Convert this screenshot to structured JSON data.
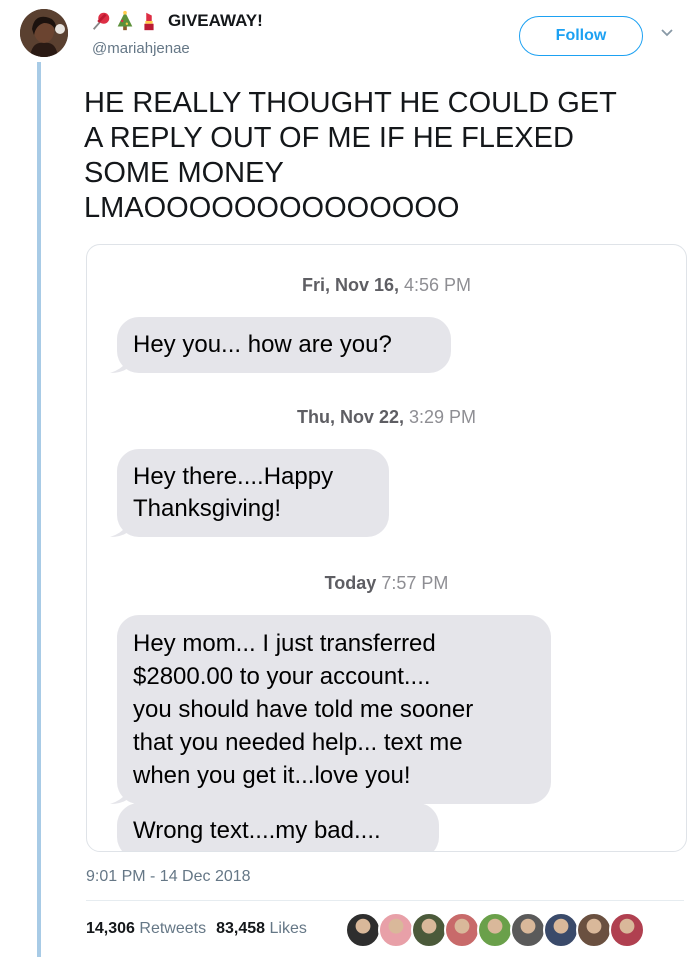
{
  "tweet": {
    "display_name": "GIVEAWAY!",
    "name_emojis": [
      "pushpin-emoji",
      "christmas-tree-emoji",
      "lipstick-emoji"
    ],
    "handle": "@mariahjenae",
    "follow_label": "Follow",
    "text": "HE REALLY THOUGHT HE COULD GET\nA REPLY OUT OF ME IF HE FLEXED\nSOME MONEY\nLMAOOOOOOOOOOOOOO",
    "timestamp": "9:01 PM - 14 Dec 2018",
    "retweets_count": "14,306",
    "retweets_label": "Retweets",
    "likes_count": "83,458",
    "likes_label": "Likes"
  },
  "messages": {
    "time1_day": "Fri, Nov 16,",
    "time1_clock": "4:56 PM",
    "bubble1": "Hey you... how are you?",
    "time2_day": "Thu, Nov 22,",
    "time2_clock": "3:29 PM",
    "bubble2_line1": "Hey there....Happy",
    "bubble2_line2": "Thanksgiving!",
    "time3_day": "Today",
    "time3_clock": "7:57 PM",
    "bubble3_line1": "Hey mom... I just transferred",
    "bubble3_line2": "$2800.00 to your account....",
    "bubble3_line3": "you should have told me sooner",
    "bubble3_line4": "that you needed help... text me",
    "bubble3_line5": "when you get it...love you!",
    "bubble4": "Wrong text....my bad...."
  },
  "colors": {
    "accent": "#1da1f2",
    "thread_line": "#a8cbe6",
    "bubble_gray": "#e5e5ea",
    "muted_text": "#657786"
  },
  "liker_avatars": [
    "#2e2e2e",
    "#e8a0a8",
    "#4b5a3a",
    "#c86a6a",
    "#6aa04a",
    "#5a5a5a",
    "#3a4a6a",
    "#6a5040",
    "#b04050"
  ]
}
